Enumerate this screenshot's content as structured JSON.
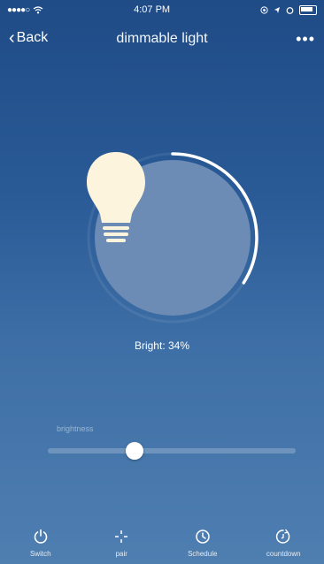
{
  "status": {
    "signal": "●●●●○",
    "time": "4:07 PM",
    "icons": [
      "location-icon",
      "alarm-icon",
      "battery-icon"
    ]
  },
  "nav": {
    "back_label": "Back",
    "title": "dimmable light",
    "more_label": "•••"
  },
  "brightness": {
    "percent": 34,
    "label_text": "Bright: 34%"
  },
  "slider": {
    "label": "brightness",
    "value_fraction": 0.35
  },
  "tabs": [
    {
      "label": "Switch",
      "icon": "power-icon"
    },
    {
      "label": "pair",
      "icon": "pair-icon"
    },
    {
      "label": "Schedule",
      "icon": "clock-icon"
    },
    {
      "label": "countdown",
      "icon": "countdown-icon"
    }
  ],
  "colors": {
    "accent": "#ffffff",
    "bulb": "#fcf4dc",
    "dial_inner": "#6c8cb5"
  }
}
